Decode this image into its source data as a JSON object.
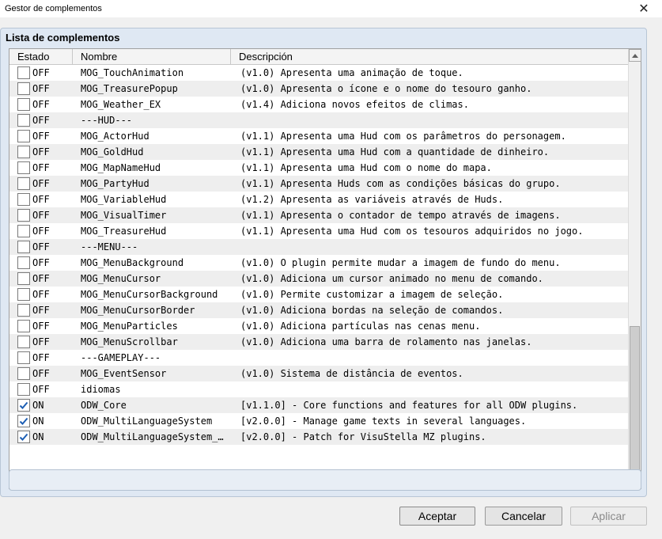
{
  "window": {
    "title": "Gestor de complementos",
    "close_glyph": "✕"
  },
  "panel": {
    "title": "Lista de complementos"
  },
  "columns": {
    "estado": "Estado",
    "nombre": "Nombre",
    "descripcion": "Descripción"
  },
  "plugins": [
    {
      "on": false,
      "state": "OFF",
      "name": "MOG_TouchAnimation",
      "desc": "(v1.0) Apresenta uma animação de toque."
    },
    {
      "on": false,
      "state": "OFF",
      "name": "MOG_TreasurePopup",
      "desc": "(v1.0) Apresenta o ícone e o nome do tesouro ganho."
    },
    {
      "on": false,
      "state": "OFF",
      "name": "MOG_Weather_EX",
      "desc": "(v1.4) Adiciona novos efeitos de climas."
    },
    {
      "on": false,
      "state": "OFF",
      "name": "---HUD---",
      "desc": ""
    },
    {
      "on": false,
      "state": "OFF",
      "name": "MOG_ActorHud",
      "desc": "(v1.1) Apresenta uma Hud com os parâmetros do personagem."
    },
    {
      "on": false,
      "state": "OFF",
      "name": "MOG_GoldHud",
      "desc": "(v1.1) Apresenta uma Hud com a quantidade de dinheiro."
    },
    {
      "on": false,
      "state": "OFF",
      "name": "MOG_MapNameHud",
      "desc": "(v1.1) Apresenta uma Hud com o nome do mapa."
    },
    {
      "on": false,
      "state": "OFF",
      "name": "MOG_PartyHud",
      "desc": "(v1.1) Apresenta Huds com as condições básicas do grupo."
    },
    {
      "on": false,
      "state": "OFF",
      "name": "MOG_VariableHud",
      "desc": "(v1.2) Apresenta as variáveis através de Huds."
    },
    {
      "on": false,
      "state": "OFF",
      "name": "MOG_VisualTimer",
      "desc": "(v1.1) Apresenta o contador de tempo através de imagens."
    },
    {
      "on": false,
      "state": "OFF",
      "name": "MOG_TreasureHud",
      "desc": "(v1.1) Apresenta uma Hud com os tesouros adquiridos no jogo."
    },
    {
      "on": false,
      "state": "OFF",
      "name": "---MENU---",
      "desc": ""
    },
    {
      "on": false,
      "state": "OFF",
      "name": "MOG_MenuBackground",
      "desc": "(v1.0) O plugin permite mudar a imagem de fundo do menu."
    },
    {
      "on": false,
      "state": "OFF",
      "name": "MOG_MenuCursor",
      "desc": "(v1.0) Adiciona um cursor animado no menu de comando."
    },
    {
      "on": false,
      "state": "OFF",
      "name": "MOG_MenuCursorBackground",
      "desc": "(v1.0) Permite customizar a imagem de seleção."
    },
    {
      "on": false,
      "state": "OFF",
      "name": "MOG_MenuCursorBorder",
      "desc": "(v1.0) Adiciona bordas na seleção de comandos."
    },
    {
      "on": false,
      "state": "OFF",
      "name": "MOG_MenuParticles",
      "desc": "(v1.0) Adiciona partículas nas cenas menu."
    },
    {
      "on": false,
      "state": "OFF",
      "name": "MOG_MenuScrollbar",
      "desc": "(v1.0) Adiciona uma barra de rolamento nas janelas."
    },
    {
      "on": false,
      "state": "OFF",
      "name": "---GAMEPLAY---",
      "desc": ""
    },
    {
      "on": false,
      "state": "OFF",
      "name": "MOG_EventSensor",
      "desc": "(v1.0) Sistema de distância de eventos."
    },
    {
      "on": false,
      "state": "OFF",
      "name": "idiomas",
      "desc": ""
    },
    {
      "on": true,
      "state": "ON",
      "name": "ODW_Core",
      "desc": "[v1.1.0] - Core functions and features for all ODW plugins."
    },
    {
      "on": true,
      "state": "ON",
      "name": "ODW_MultiLanguageSystem",
      "desc": "[v2.0.0] - Manage game texts in several languages."
    },
    {
      "on": true,
      "state": "ON",
      "name": "ODW_MultiLanguageSystem_…",
      "desc": "[v2.0.0] - Patch for VisuStella MZ plugins."
    }
  ],
  "buttons": {
    "aceptar": "Aceptar",
    "cancelar": "Cancelar",
    "aplicar": "Aplicar"
  },
  "scroll": {
    "position_fraction": 0.66
  },
  "icons": {
    "check": "checkmark-icon",
    "up": "scroll-up-arrow-icon",
    "down": "scroll-down-arrow-icon",
    "close": "close-icon"
  },
  "colors": {
    "check": "#1e5fb4",
    "panel": "#dfe8f3"
  }
}
